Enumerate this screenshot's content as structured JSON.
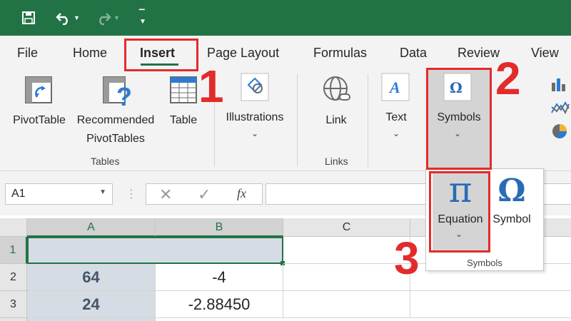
{
  "tabs": [
    "File",
    "Home",
    "Insert",
    "Page Layout",
    "Formulas",
    "Data",
    "Review",
    "View"
  ],
  "ribbon": {
    "pivottable": "PivotTable",
    "recommended": "Recommended",
    "pivottables": "PivotTables",
    "table": "Table",
    "tables_group": "Tables",
    "illustrations": "Illustrations",
    "link": "Link",
    "links_group": "Links",
    "text": "Text",
    "symbols": "Symbols"
  },
  "formula_bar": {
    "name_box": "A1",
    "fx": "fx",
    "formula": ""
  },
  "grid": {
    "columns": [
      "A",
      "B",
      "C"
    ],
    "rows": [
      "1",
      "2",
      "3"
    ],
    "cells": {
      "A2": "64",
      "B2": "-4",
      "A3": "24",
      "B3": "-2.88450"
    }
  },
  "symbols_menu": {
    "equation": "Equation",
    "symbol": "Symbol",
    "group": "Symbols",
    "pi_glyph": "π",
    "omega_glyph": "Ω"
  },
  "annotations": {
    "step1": "1",
    "step2": "2",
    "step3": "3"
  },
  "colors": {
    "accent": "#217346",
    "annotation": "#e32b2b",
    "selection_shade": "#d6dce4"
  }
}
